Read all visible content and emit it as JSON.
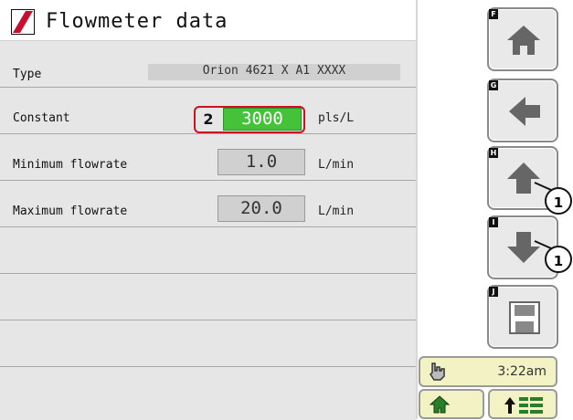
{
  "header": {
    "title": "Flowmeter data"
  },
  "rows": [
    {
      "label": "Type",
      "value": "Orion 4621 X A1 XXXX",
      "unit": ""
    },
    {
      "label": "Constant",
      "value": "3000",
      "unit": "pls/L"
    },
    {
      "label": "Minimum flowrate",
      "value": "1.0",
      "unit": "L/min"
    },
    {
      "label": "Maximum flowrate",
      "value": "20.0",
      "unit": "L/min"
    }
  ],
  "callouts": {
    "constant": "2",
    "up": "1",
    "down": "1"
  },
  "side_buttons": [
    {
      "tag": "F",
      "icon": "home-icon"
    },
    {
      "tag": "G",
      "icon": "back-arrow-icon"
    },
    {
      "tag": "H",
      "icon": "arrow-up-icon"
    },
    {
      "tag": "I",
      "icon": "arrow-down-icon"
    },
    {
      "tag": "J",
      "icon": "save-icon"
    }
  ],
  "status": {
    "time": "3:22am"
  },
  "colors": {
    "highlight": "#44c23a",
    "logo_red": "#c8102e",
    "callout_border": "#cc1122"
  }
}
